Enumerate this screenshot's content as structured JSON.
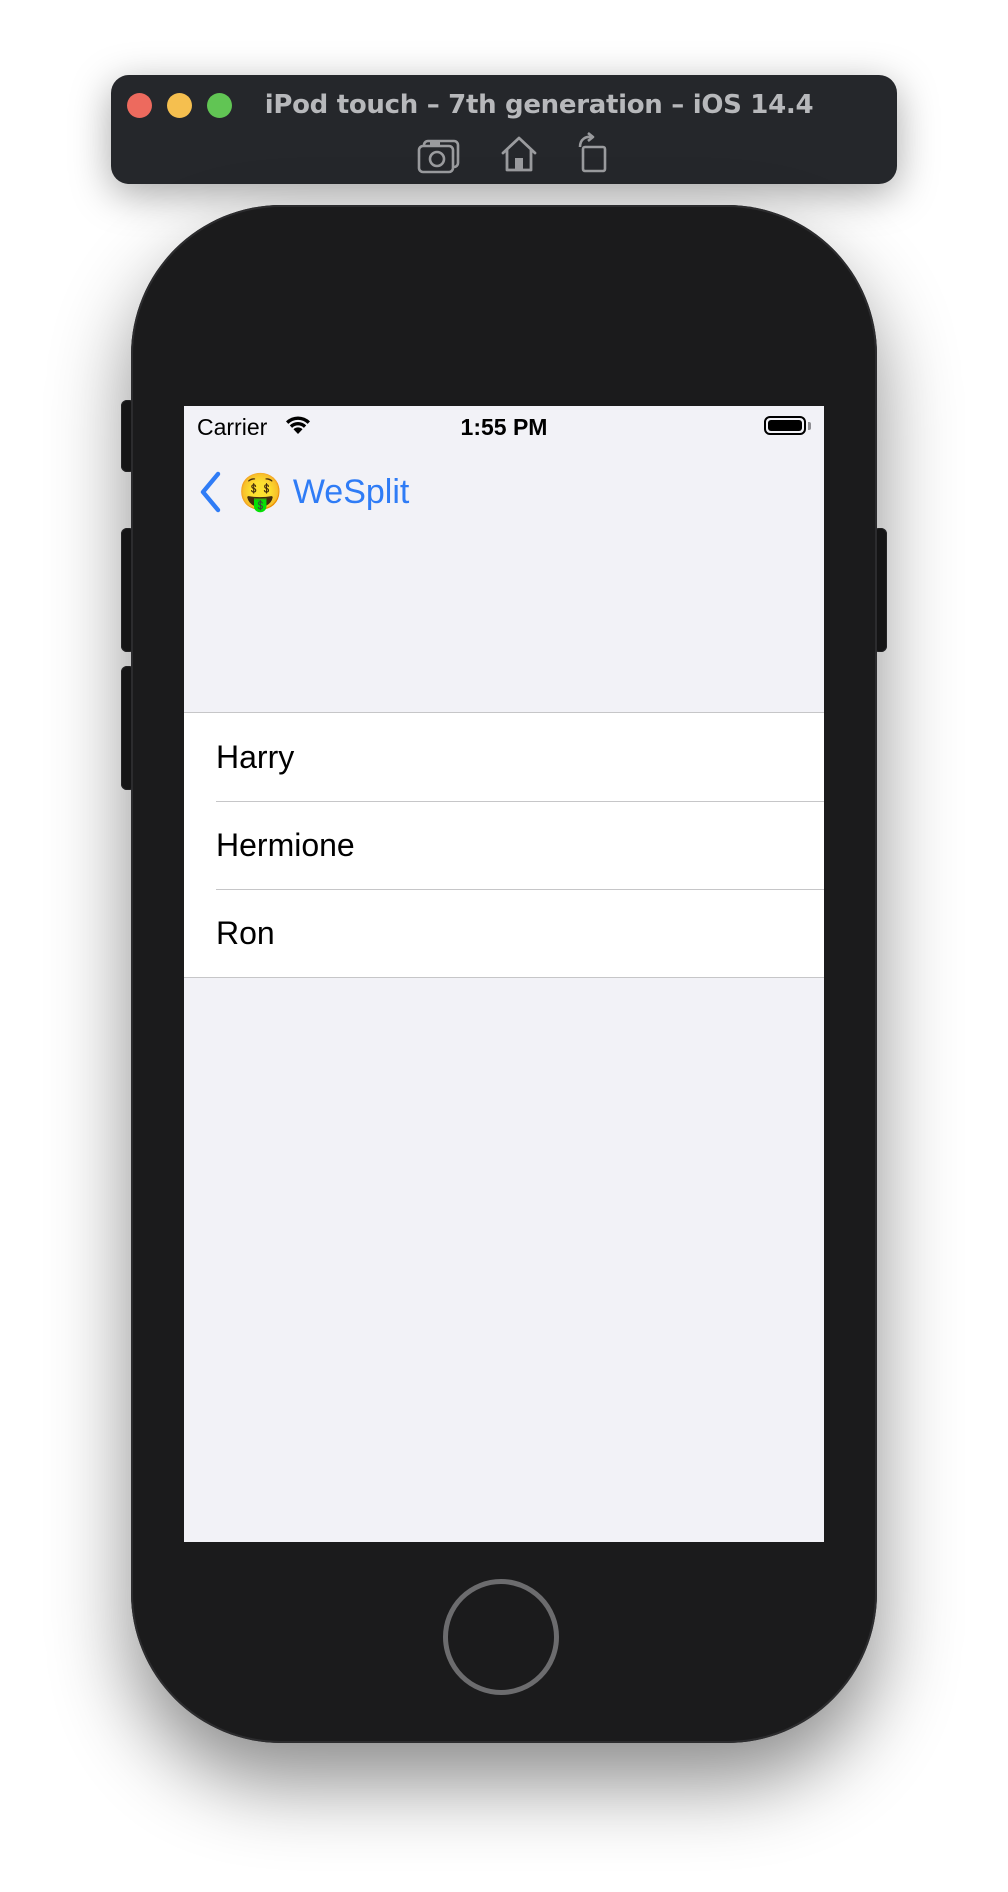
{
  "simulator": {
    "title": "iPod touch – 7th generation – iOS 14.4",
    "traffic_lights": {
      "close_color": "#ed6a5e",
      "minimize_color": "#f5bf4f",
      "zoom_color": "#61c554"
    },
    "toolbar_icons": [
      "screenshot-icon",
      "home-icon",
      "rotate-icon"
    ]
  },
  "status_bar": {
    "carrier": "Carrier",
    "time": "1:55 PM",
    "battery_level": 1.0
  },
  "nav": {
    "back_emoji": "🤑",
    "back_label": "WeSplit",
    "accent_color": "#2f7cf6"
  },
  "list": {
    "items": [
      {
        "label": "Harry"
      },
      {
        "label": "Hermione"
      },
      {
        "label": "Ron"
      }
    ]
  }
}
